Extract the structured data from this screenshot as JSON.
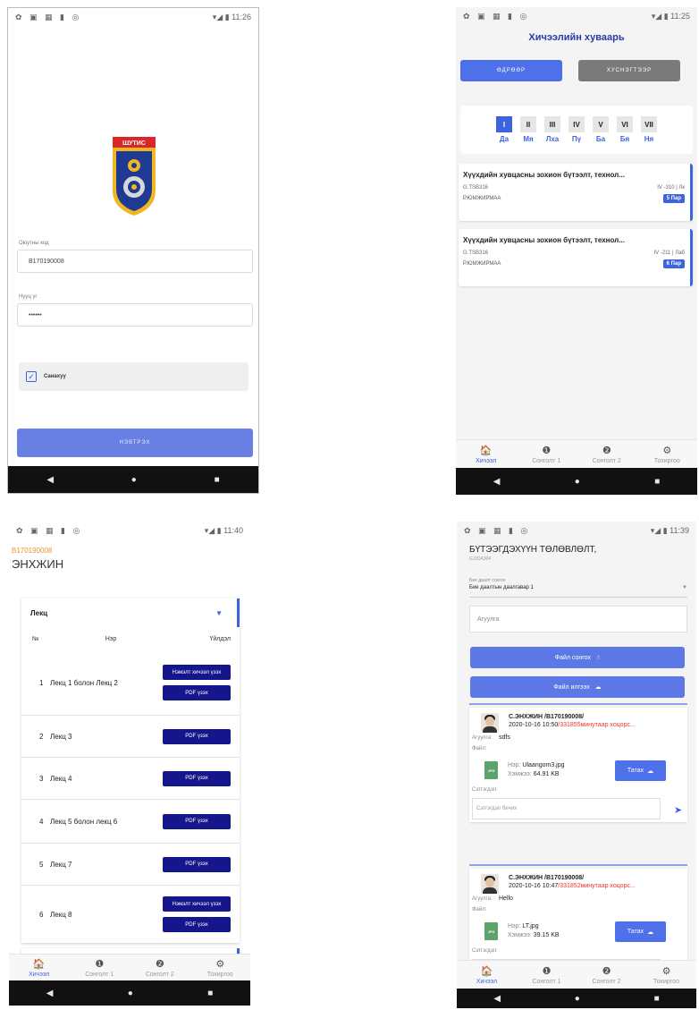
{
  "status": {
    "icons": "✿ ▣ ▦ ▮ ◎",
    "p1_time": "▾◢ ▮ 11:26",
    "p2_time": "▾◢ ▮ 11:25",
    "p3_time": "▾◢ ▮ 11:40",
    "p4_time": "▾◢ ▮ 11:39"
  },
  "navbar": {
    "back": "◀",
    "home": "●",
    "recent": "■"
  },
  "login": {
    "logo_text": "ШУТИС",
    "username_label": "Оюутны код",
    "username_value": "B170190008",
    "password_label": "Нууц үг",
    "password_value": "••••••",
    "remember_label": "Санахуу",
    "remember_checked": true,
    "login_button": "НЭВТРЭХ"
  },
  "schedule": {
    "title": "Хичээлийн хуваарь",
    "seg_daily": "ӨДРӨӨР",
    "seg_semester": "ХУСНЭГТЭЭР",
    "days": [
      {
        "num": "I",
        "label": "Да",
        "active": true
      },
      {
        "num": "II",
        "label": "Мя",
        "active": false
      },
      {
        "num": "III",
        "label": "Лха",
        "active": false
      },
      {
        "num": "IV",
        "label": "Пү",
        "active": false
      },
      {
        "num": "V",
        "label": "Ба",
        "active": false
      },
      {
        "num": "VI",
        "label": "Бя",
        "active": false
      },
      {
        "num": "VII",
        "label": "Ня",
        "active": false
      }
    ],
    "lessons": [
      {
        "title": "Хүүхдийн хувцасны зохион бүтээлт, технол...",
        "code": "G.TSB316",
        "room": "IV -310 | Лк",
        "teacher": "Р.ЮМЖИРМАА",
        "period": "5 Пар"
      },
      {
        "title": "Хүүхдийн хувцасны зохион бүтээлт, технол...",
        "code": "G.TSB316",
        "room": "IV -211 | Лаб",
        "teacher": "Р.ЮМЖИРМАА",
        "period": "6 Пар"
      }
    ]
  },
  "tabs": [
    {
      "icon": "🏠",
      "label": "Хичээл"
    },
    {
      "icon": "❶",
      "label": "Сонголт 1"
    },
    {
      "icon": "❷",
      "label": "Сонголт 2"
    },
    {
      "icon": "⚙",
      "label": "Тохиргоо"
    }
  ],
  "lectures": {
    "student_code": "B170190008",
    "student_name": "ЭНХЖИН",
    "select_value": "Лекц",
    "col_no": "№",
    "col_name": "Нэр",
    "col_action": "Үйлдэл",
    "rows": [
      {
        "no": "1",
        "name": "Лекц 1 болон Лекц 2",
        "extra": "Нэмэлт хичээл үзэх",
        "pdf": "PDF үзэх"
      },
      {
        "no": "2",
        "name": "Лекц 3",
        "pdf": "PDF үзэх"
      },
      {
        "no": "3",
        "name": "Лекц 4",
        "pdf": "PDF үзэх"
      },
      {
        "no": "4",
        "name": "Лекц 5 болон лекц 6",
        "pdf": "PDF үзэх"
      },
      {
        "no": "5",
        "name": "Лекц 7",
        "pdf": "PDF үзэх"
      },
      {
        "no": "6",
        "name": "Лекц 8",
        "extra": "Нэмэлт хичээл үзэх",
        "pdf": "PDF үзэх"
      }
    ]
  },
  "planning": {
    "title": "БҮТЭЭГДЭХҮҮН ТӨЛӨВЛӨЛТ,",
    "code": "G.DDA304",
    "select_label": "Бие даалт сонгох",
    "select_value": "Бие даалтын даалгавар 1",
    "content_placeholder": "Агуулга",
    "choose_file": "Файл сонгох",
    "upload_file": "Файл илгээх",
    "label_content": "Агуулга:",
    "label_file": "Файл:",
    "label_name": "Нэр:",
    "label_size": "Хэмжээ:",
    "label_comment": "Сэтгэгдэл:",
    "comment_placeholder": "Сэтгэгдэл бичих",
    "download": "Татах",
    "posts": [
      {
        "author": "С.ЭНХЖИН /B170190008/",
        "date": "2020-10-16 10:50",
        "late": "/331855минутаар хоцорс...",
        "content": "sdfs",
        "file_type": "JPG",
        "file_name": "Ulaangom3.jpg",
        "file_size": "64.91 KB"
      },
      {
        "author": "С.ЭНХЖИН /B170190008/",
        "date": "2020-10-16 10:47",
        "late": "/331852минутаар хоцорс...",
        "content": "Hello",
        "file_type": "JPG",
        "file_name": "LT.jpg",
        "file_size": "39.15 KB"
      }
    ]
  },
  "colors": {
    "accent": "#3d63dd",
    "dark_button": "#16168c",
    "late": "#e33333",
    "code": "#e8932e"
  }
}
